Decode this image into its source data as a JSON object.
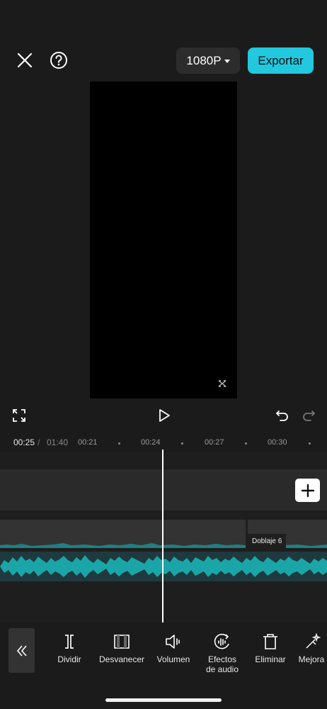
{
  "header": {
    "resolution_label": "1080P",
    "export_label": "Exportar"
  },
  "timeline": {
    "current_time": "00:25",
    "separator": "/",
    "total_time": "01:40",
    "ticks": [
      "00:21",
      "00:24",
      "00:27",
      "00:30"
    ],
    "audio_clip_label": "Doblaje 6"
  },
  "toolbar": {
    "items": [
      {
        "label": "Dividir",
        "icon": "split-icon"
      },
      {
        "label": "Desvanecer",
        "icon": "fade-icon"
      },
      {
        "label": "Volumen",
        "icon": "volume-icon"
      },
      {
        "label": "Efectos\nde audio",
        "icon": "audio-effects-icon"
      },
      {
        "label": "Eliminar",
        "icon": "trash-icon"
      },
      {
        "label": "Mejora",
        "icon": "enhance-icon"
      }
    ]
  },
  "colors": {
    "accent": "#22c9de",
    "waveform": "#1aa6a8"
  }
}
